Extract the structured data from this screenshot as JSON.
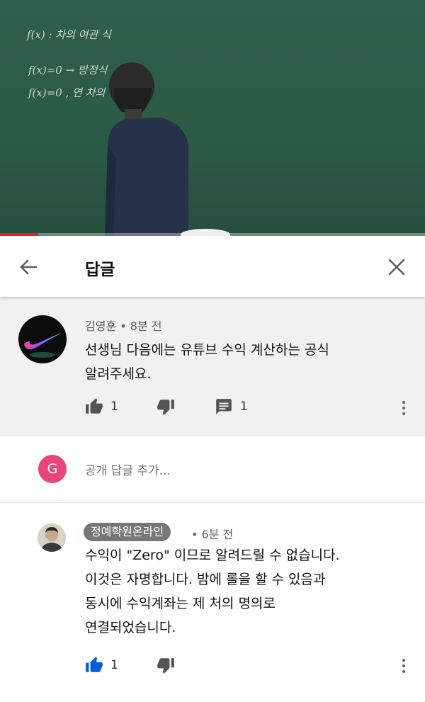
{
  "video": {
    "board_lines": [
      "f(x) : 차의 여관 식",
      "f(x)=0 → 방정식",
      "f(x)=0 , 연 차의"
    ],
    "progress": 0.09
  },
  "header": {
    "title": "답글",
    "back_icon": "arrow-left-icon",
    "close_icon": "close-icon"
  },
  "original_comment": {
    "author": "김영훈",
    "separator": "•",
    "time": "8분 전",
    "text_lines": [
      "선생님 다음에는 유튜브 수익 계산하는 공식",
      "알려주세요."
    ],
    "likes": "1",
    "replies": "1"
  },
  "add_reply": {
    "avatar_letter": "G",
    "avatar_color": "#e8457a",
    "placeholder": "공개 답글 추가..."
  },
  "reply": {
    "author": "정예학원온라인",
    "separator": "•",
    "time": "6분 전",
    "text_lines": [
      "수익이 \"Zero\" 이므로 알려드릴 수 없습니다.",
      "이것은 자명합니다. 밤에 롤을 할 수 있음과",
      "동시에 수익계좌는 제 처의 명의로",
      "연결되었습니다."
    ],
    "likes": "1",
    "like_color": "#065fd4"
  }
}
